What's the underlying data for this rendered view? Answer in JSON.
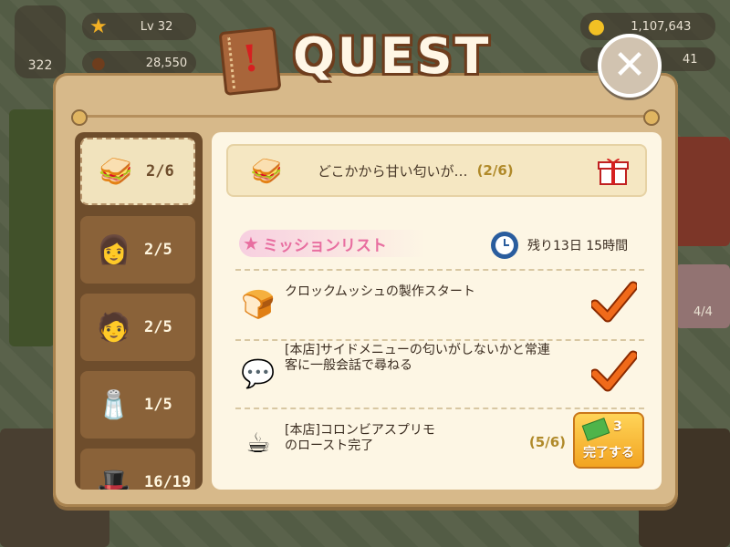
{
  "hud": {
    "collect_count": "322",
    "level": "Lv 32",
    "coins": "28,550",
    "money": "1,107,643",
    "gems": "41",
    "right_badge": "4/4"
  },
  "popup": {
    "title": "QUEST",
    "close_symbol": "✕"
  },
  "sidebar": {
    "tabs": [
      {
        "icon": "sandwich-icon",
        "count": "2/6",
        "active": true
      },
      {
        "icon": "group-portrait-icon",
        "count": "2/5",
        "active": false
      },
      {
        "icon": "man-portrait-icon",
        "count": "2/5",
        "active": false
      },
      {
        "icon": "utensil-holder-icon",
        "count": "1/5",
        "active": false
      },
      {
        "icon": "hat-portrait-icon",
        "count": "16/19",
        "active": false
      }
    ]
  },
  "quest": {
    "icon": "sandwich-icon",
    "title": "どこかから甘い匂いが…",
    "progress": "(2/6)",
    "reward_icon": "gift-icon"
  },
  "missions_header": {
    "label": "ミッションリスト",
    "timer": "残り13日 15時間"
  },
  "missions": [
    {
      "icon": "croque-monsieur-icon",
      "text": "クロックムッシュの製作スタート",
      "status": "done"
    },
    {
      "icon": "chat-group-icon",
      "text": "[本店]サイドメニューの匂いがしないかと常連客に一般会話で尋ねる",
      "status": "done"
    },
    {
      "icon": "coffee-bag-icon",
      "text": "[本店]コロンビアスプリモのロースト完了",
      "status": "in-progress",
      "progress": "(5/6)",
      "button_reward": "3",
      "button_label": "完了する"
    }
  ],
  "colors": {
    "accent_pink": "#e86ea0",
    "check_orange": "#f06a1a",
    "button_gold": "#f2a421"
  }
}
